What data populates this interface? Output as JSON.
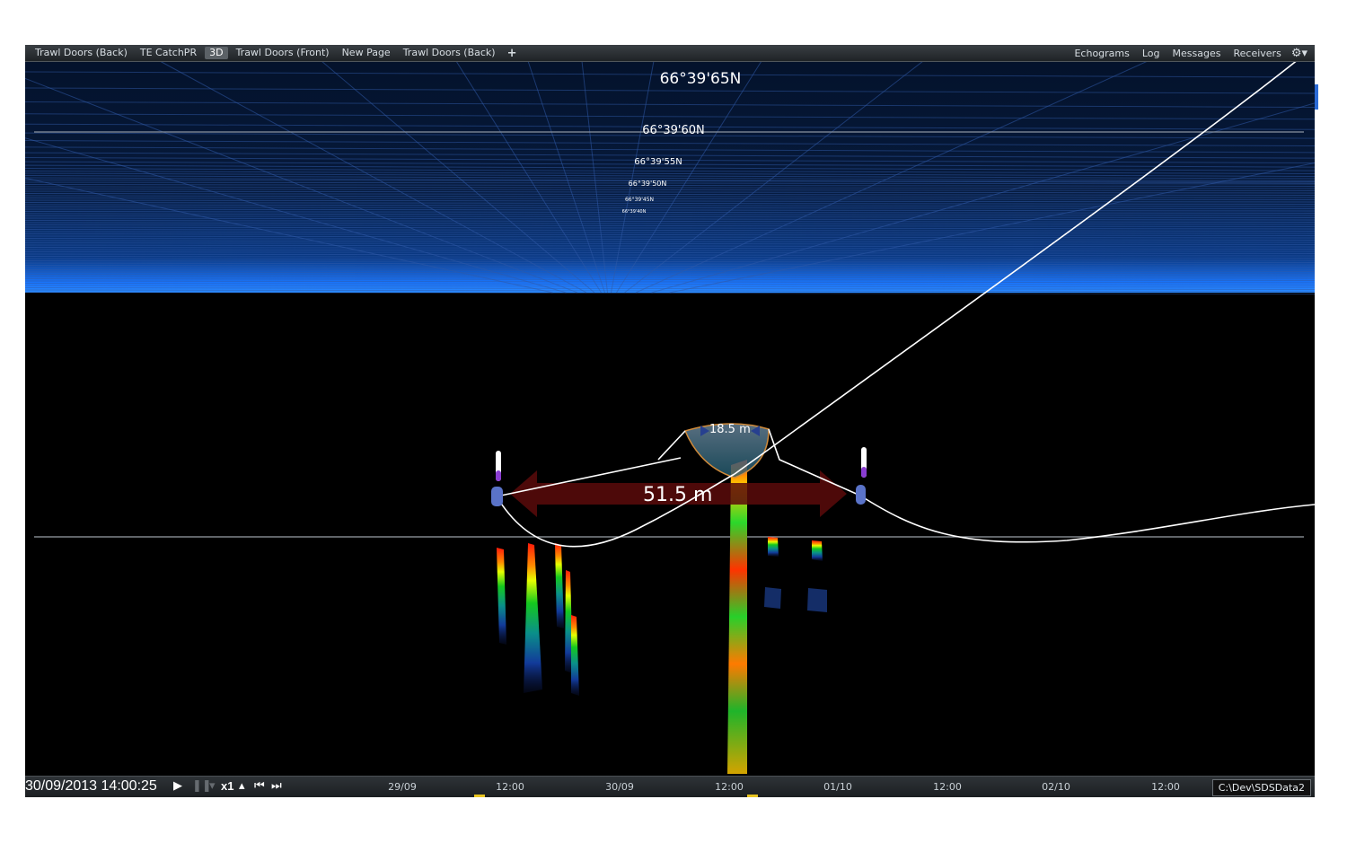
{
  "tabs": [
    {
      "label": "Trawl Doors (Back)"
    },
    {
      "label": "TE CatchPR"
    },
    {
      "label": "3D",
      "active": true
    },
    {
      "label": "Trawl Doors (Front)"
    },
    {
      "label": "New Page"
    },
    {
      "label": "Trawl Doors (Back)"
    }
  ],
  "add_tab_icon": "+",
  "right_links": [
    "Echograms",
    "Log",
    "Messages",
    "Receivers"
  ],
  "settings_icon": "gear-icon",
  "latitude_labels": [
    "66°39'65N",
    "66°39'60N",
    "66°39'55N",
    "66°39'50N",
    "66°39'45N",
    "66°39'40N"
  ],
  "measurements": {
    "door_spread": "51.5 m",
    "net_opening": "18.5 m"
  },
  "timeline": {
    "timestamp": "30/09/2013 14:00:25",
    "speed": "x1",
    "ticks": [
      "29/09",
      "12:00",
      "30/09",
      "12:00",
      "01/10",
      "12:00",
      "02/10",
      "12:00"
    ],
    "data_path": "C:\\Dev\\SDSData2"
  },
  "colors": {
    "sky_top": "#04122b",
    "horizon": "#1a77ff",
    "spread_arrow": "#5a0a0a",
    "cable": "#ffffff",
    "marker": "#e8c420"
  }
}
